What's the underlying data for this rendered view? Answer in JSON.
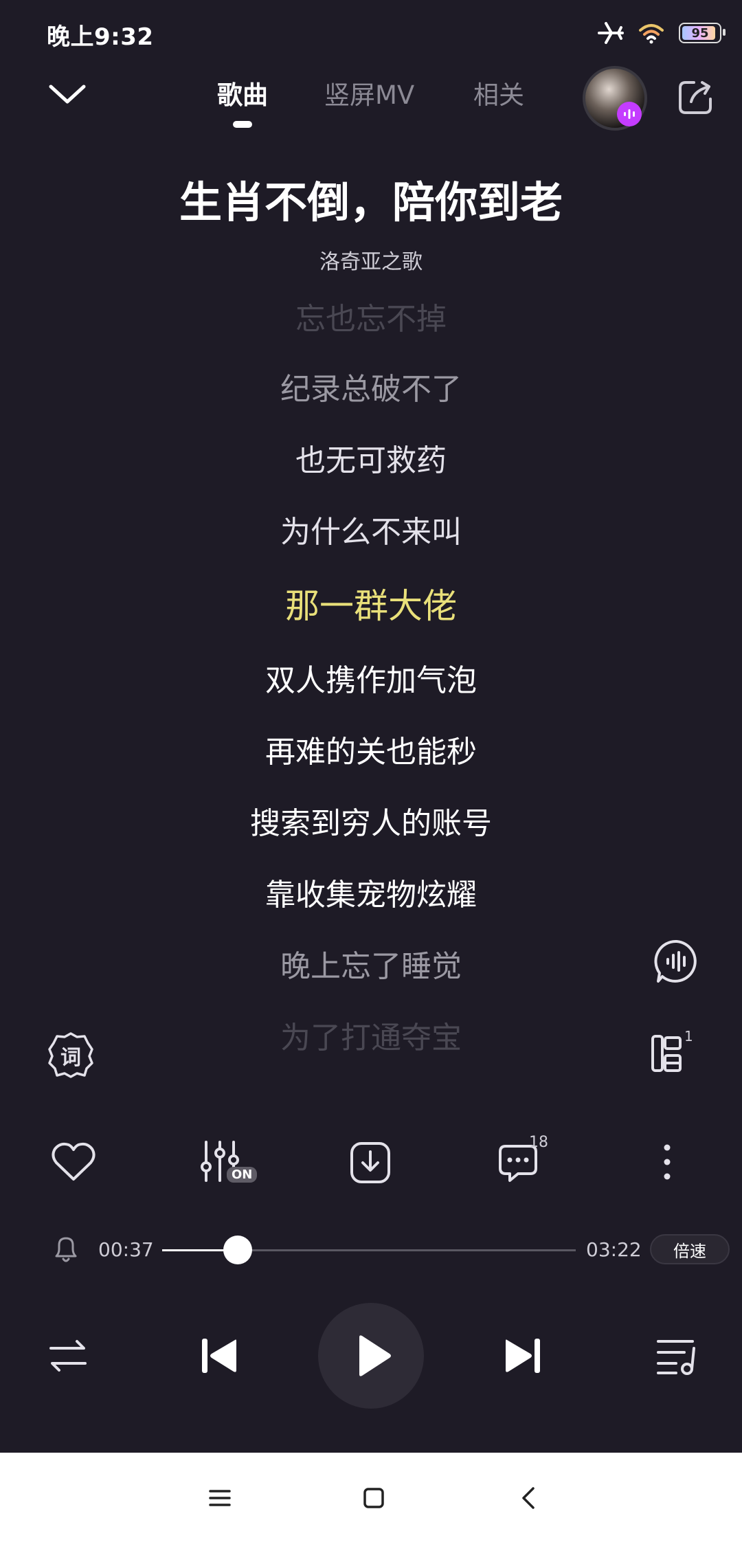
{
  "status_bar": {
    "time": "晚上9:32",
    "battery": "95",
    "icons": [
      "airplane-icon",
      "wifi-icon",
      "battery-icon"
    ]
  },
  "header": {
    "tabs": [
      {
        "label": "歌曲",
        "active": true
      },
      {
        "label": "竖屏MV",
        "active": false
      },
      {
        "label": "相关",
        "active": false
      }
    ]
  },
  "song": {
    "title": "生肖不倒，陪你到老",
    "artist": "洛奇亚之歌"
  },
  "lyrics": [
    "忘也忘不掉",
    "纪录总破不了",
    "也无可救药",
    "为什么不来叫",
    "那一群大佬",
    "双人携作加气泡",
    "再难的关也能秒",
    "搜索到穷人的账号",
    "靠收集宠物炫耀",
    "晚上忘了睡觉",
    "为了打通夺宝"
  ],
  "current_lyric_index": 4,
  "side_buttons": {
    "lyrics_label": "词",
    "sing_count": "1"
  },
  "actions": {
    "eq_badge": "ON",
    "comment_count": "18"
  },
  "progress": {
    "current": "00:37",
    "total": "03:22",
    "fraction": 0.183,
    "speed_label": "倍速"
  },
  "colors": {
    "background": "#1e1b26",
    "highlight": "#e9e07a",
    "badge": "#c43cff"
  }
}
